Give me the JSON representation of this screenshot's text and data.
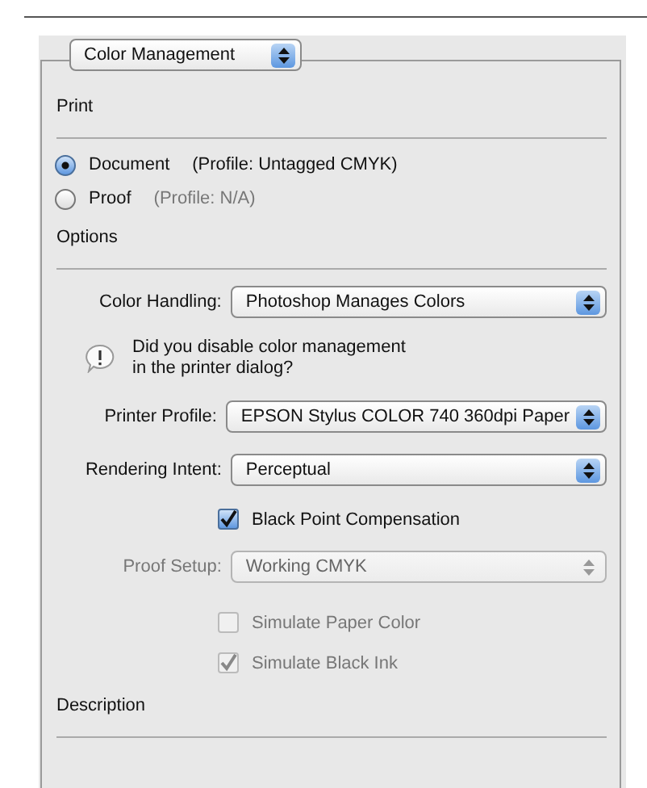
{
  "section_popup": {
    "value": "Color Management"
  },
  "print": {
    "heading": "Print",
    "sources": [
      {
        "label": "Document",
        "profile": "(Profile: Untagged CMYK)",
        "selected": true,
        "profile_disabled": false
      },
      {
        "label": "Proof",
        "profile": "(Profile: N/A)",
        "selected": false,
        "profile_disabled": true
      }
    ]
  },
  "options": {
    "heading": "Options",
    "rows": [
      {
        "kind": "popup",
        "label": "Color Handling:",
        "value": "Photoshop Manages Colors",
        "disabled": false
      },
      {
        "kind": "notice",
        "text": "Did you disable color management\nin the printer dialog?"
      },
      {
        "kind": "popup",
        "label": "Printer Profile:",
        "value": "EPSON Stylus COLOR 740 360dpi Paper",
        "disabled": false
      },
      {
        "kind": "popup",
        "label": "Rendering Intent:",
        "value": "Perceptual",
        "disabled": false
      },
      {
        "kind": "checkbox",
        "label": "Black Point Compensation",
        "checked": true,
        "disabled": false
      },
      {
        "kind": "popup",
        "label": "Proof Setup:",
        "value": "Working CMYK",
        "disabled": true
      },
      {
        "kind": "checkbox",
        "label": "Simulate Paper Color",
        "checked": false,
        "disabled": true
      },
      {
        "kind": "checkbox",
        "label": "Simulate Black Ink",
        "checked": true,
        "disabled": true
      }
    ]
  },
  "description": {
    "heading": "Description"
  }
}
